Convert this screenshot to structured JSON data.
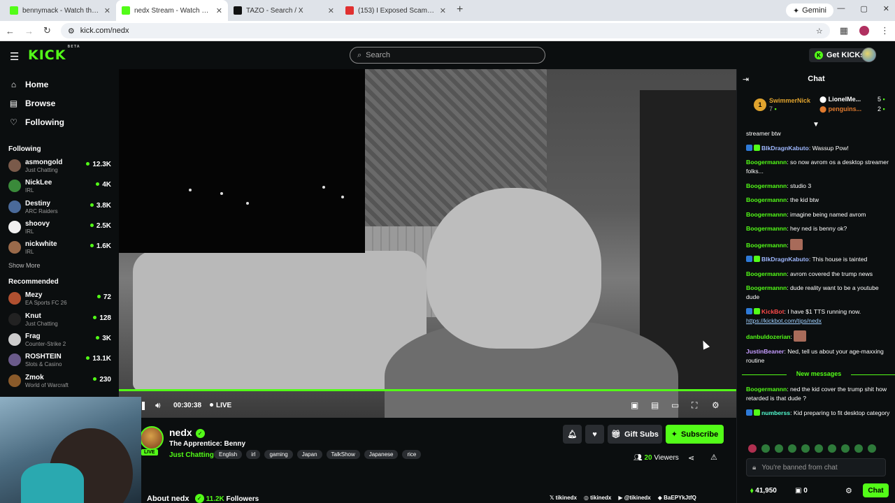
{
  "browser": {
    "tabs": [
      {
        "title": "bennymack - Watch the VOD o",
        "color": "#53fc18",
        "active": false
      },
      {
        "title": "nedx Stream - Watch Live o",
        "color": "#53fc18",
        "active": true
      },
      {
        "title": "TAZO - Search / X",
        "color": "#111111",
        "active": false
      },
      {
        "title": "(153) I Exposed Scammers in To",
        "color": "#e03030",
        "active": false
      }
    ],
    "gemini_label": "Gemini",
    "url": "kick.com/nedx"
  },
  "header": {
    "logo": "KICK",
    "logo_sup": "BETA",
    "search_placeholder": "Search",
    "get_kicks_label": "Get KICKs"
  },
  "sidebar": {
    "nav": [
      {
        "label": "Home",
        "icon": "home-icon"
      },
      {
        "label": "Browse",
        "icon": "browse-icon"
      },
      {
        "label": "Following",
        "icon": "heart-icon"
      }
    ],
    "following_title": "Following",
    "following": [
      {
        "name": "asmongold",
        "category": "Just Chatting",
        "viewers": "12.3K",
        "color": "#7a5a4a"
      },
      {
        "name": "NickLee",
        "category": "IRL",
        "viewers": "4K",
        "color": "#3a8a3a"
      },
      {
        "name": "Destiny",
        "category": "ARC Raiders",
        "viewers": "3.8K",
        "color": "#4a6a9a"
      },
      {
        "name": "shoovy",
        "category": "IRL",
        "viewers": "2.5K",
        "color": "#f0f0f0"
      },
      {
        "name": "nickwhite",
        "category": "IRL",
        "viewers": "1.6K",
        "color": "#9a6a4a"
      }
    ],
    "show_more": "Show More",
    "recommended_title": "Recommended",
    "recommended": [
      {
        "name": "Mezy",
        "category": "EA Sports FC 26",
        "viewers": "72",
        "color": "#b05030"
      },
      {
        "name": "Knut",
        "category": "Just Chatting",
        "viewers": "128",
        "color": "#222222"
      },
      {
        "name": "Frag",
        "category": "Counter-Strike 2",
        "viewers": "3K",
        "color": "#cccccc"
      },
      {
        "name": "ROSHTEIN",
        "category": "Slots & Casino",
        "viewers": "13.1K",
        "color": "#6a5a8a"
      },
      {
        "name": "Zmok",
        "category": "World of Warcraft",
        "viewers": "230",
        "color": "#8a5a2a"
      }
    ]
  },
  "player": {
    "time": "00:30:38",
    "live_label": "LIVE"
  },
  "stream": {
    "name": "nedx",
    "title": "The Apprentice: Benny",
    "category": "Just Chatting",
    "live_badge": "LIVE",
    "tags": [
      "English",
      "irl",
      "gaming",
      "Japan",
      "TalkShow",
      "Japanese",
      "rice"
    ],
    "gift_subs_label": "Gift Subs",
    "subscribe_label": "Subscribe",
    "viewers_count": "20",
    "viewers_label": "Viewers",
    "about_label": "About nedx",
    "followers_count": "11.2K",
    "followers_label": "Followers",
    "socials": [
      "tikinedx",
      "tikinedx",
      "@tikinedx",
      "BaEPYkJtfQ"
    ]
  },
  "chat": {
    "title": "Chat",
    "pinned": {
      "rank": "1",
      "top_name": "SwimmerNick",
      "top_count": "7",
      "row1_name": "LionelMe...",
      "row1_count": "5",
      "row2_name": "penguins...",
      "row2_count": "2"
    },
    "top_fragment": "streamer btw",
    "messages": [
      {
        "user": "BlkDragnKabuto",
        "color": "#9fb8ff",
        "text": "Wassup Pow!",
        "badges": true
      },
      {
        "user": "Boogermannn",
        "color": "#53fc18",
        "text": "so now avrom os a desktop streamer folks..."
      },
      {
        "user": "Boogermannn",
        "color": "#53fc18",
        "text": "studio 3"
      },
      {
        "user": "Boogermannn",
        "color": "#53fc18",
        "text": "the kid btw"
      },
      {
        "user": "Boogermannn",
        "color": "#53fc18",
        "text": "imagine being named avrom"
      },
      {
        "user": "Boogermannn",
        "color": "#53fc18",
        "text": "hey ned is benny ok?"
      },
      {
        "user": "Boogermannn",
        "color": "#53fc18",
        "text": "",
        "emote": true
      },
      {
        "user": "BlkDragnKabuto",
        "color": "#9fb8ff",
        "text": "This house is tainted",
        "badges": true
      },
      {
        "user": "Boogermannn",
        "color": "#53fc18",
        "text": "avrom covered the trump news"
      },
      {
        "user": "Boogermannn",
        "color": "#53fc18",
        "text": "dude reality want to be a youtube dude"
      },
      {
        "user": "KickBot",
        "color": "#ff4a4a",
        "text": "I have $1 TTS running now.",
        "link": "https://kickbot.com/tips/nedx",
        "badges": true
      },
      {
        "user": "danbuldozerian",
        "color": "#53fc18",
        "text": "",
        "emote": true
      },
      {
        "user": "JustinBeaner",
        "color": "#c59cff",
        "text": "Ned, tell us about your age-maxxing routine"
      }
    ],
    "new_messages_label": "New messages",
    "new_messages": [
      {
        "user": "Boogermannn",
        "color": "#53fc18",
        "text": "ned the kid cover the trump shit how retarded is that dude ?"
      },
      {
        "user": "numberss",
        "color": "#53fcd0",
        "text": "Kid preparing to fit desktop category",
        "badges": true
      }
    ],
    "banned_text": "You're banned from chat",
    "points": "41,950",
    "kicks": "0",
    "chat_button": "Chat"
  }
}
